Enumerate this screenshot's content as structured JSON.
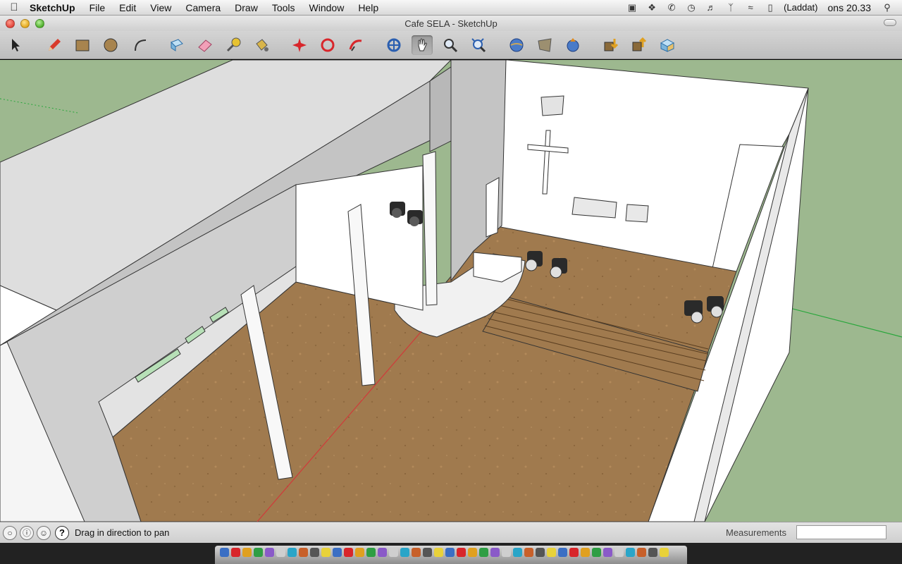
{
  "menubar": {
    "app_name": "SketchUp",
    "items": [
      "File",
      "Edit",
      "View",
      "Camera",
      "Draw",
      "Tools",
      "Window",
      "Help"
    ],
    "battery_label": "(Laddat)",
    "clock": "ons 20.33"
  },
  "window": {
    "title": "Cafe SELA - SketchUp"
  },
  "toolbar": {
    "tools": [
      {
        "name": "select-tool",
        "icon": "arrow-icon"
      },
      {
        "name": "pencil-tool",
        "icon": "pencil-icon"
      },
      {
        "name": "rectangle-tool",
        "icon": "rectangle-icon"
      },
      {
        "name": "circle-tool",
        "icon": "circle-icon"
      },
      {
        "name": "arc-tool",
        "icon": "arc-icon"
      },
      {
        "name": "make-component-tool",
        "icon": "component-icon"
      },
      {
        "name": "eraser-tool",
        "icon": "eraser-icon"
      },
      {
        "name": "tape-measure-tool",
        "icon": "tape-icon"
      },
      {
        "name": "paint-bucket-tool",
        "icon": "bucket-icon"
      },
      {
        "name": "push-pull-tool",
        "icon": "push-pull-icon"
      },
      {
        "name": "move-tool",
        "icon": "move-icon"
      },
      {
        "name": "rotate-tool",
        "icon": "rotate-icon"
      },
      {
        "name": "follow-me-tool",
        "icon": "follow-me-icon"
      },
      {
        "name": "orbit-tool",
        "icon": "orbit-icon"
      },
      {
        "name": "pan-tool",
        "icon": "hand-icon",
        "active": true
      },
      {
        "name": "zoom-tool",
        "icon": "magnifier-icon"
      },
      {
        "name": "zoom-extents-tool",
        "icon": "zoom-extents-icon"
      },
      {
        "name": "previous-view-tool",
        "icon": "globe-icon"
      },
      {
        "name": "position-camera-tool",
        "icon": "map-icon"
      },
      {
        "name": "walk-tool",
        "icon": "globe-arrow-icon"
      },
      {
        "name": "get-models-tool",
        "icon": "download-icon"
      },
      {
        "name": "share-model-tool",
        "icon": "upload-icon"
      },
      {
        "name": "preview-google-earth-tool",
        "icon": "box-icon"
      }
    ]
  },
  "statusbar": {
    "hint": "Drag in direction to pan",
    "measurements_label": "Measurements",
    "measurements_value": ""
  },
  "colors": {
    "ground": "#9db88f",
    "floor": "#a07a4e",
    "wall_grey": "#c8c8c8",
    "wall_white": "#ffffff",
    "axis_red": "#d03a3a",
    "axis_green": "#27a63a"
  }
}
